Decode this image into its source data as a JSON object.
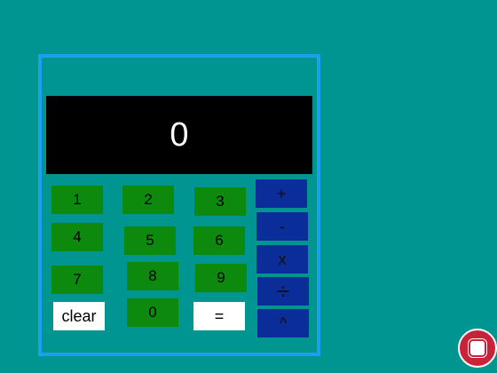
{
  "calculator": {
    "display": "0",
    "keys": {
      "k1": "1",
      "k2": "2",
      "k3": "3",
      "k4": "4",
      "k5": "5",
      "k6": "6",
      "k7": "7",
      "k8": "8",
      "k9": "9",
      "k0": "0",
      "clear": "clear",
      "equals": "="
    },
    "ops": {
      "plus": "+",
      "minus": "-",
      "times": "x",
      "divide": "÷",
      "power": "^"
    }
  },
  "colors": {
    "background": "#019592",
    "frame": "#1d9ff0",
    "number_key": "#0d8a0d",
    "operator_key": "#0a2d9a",
    "stop_button": "#c9233a"
  },
  "icons": {
    "stop": "stop-icon"
  }
}
